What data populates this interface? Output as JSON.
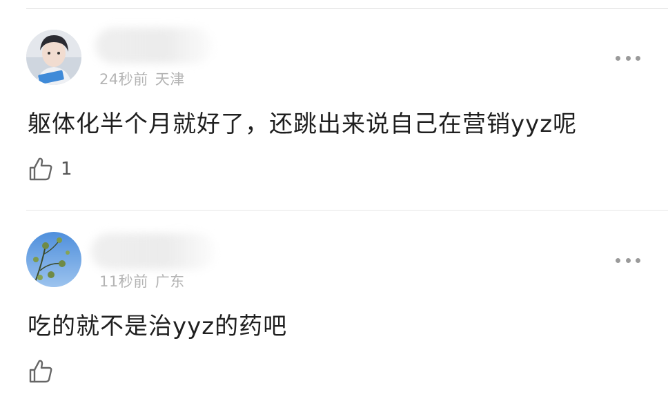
{
  "comments": [
    {
      "time": "24秒前",
      "location": "天津",
      "text": "躯体化半个月就好了，还跳出来说自己在营销yyz呢",
      "likes": "1",
      "avatar_icon": "avatar-person-photo"
    },
    {
      "time": "11秒前",
      "location": "广东",
      "text": "吃的就不是治yyz的药吧",
      "likes": "",
      "avatar_icon": "avatar-sky-tree-photo"
    }
  ],
  "icons": {
    "more": "more-dots-icon",
    "like": "thumbs-up-icon"
  },
  "colors": {
    "meta": "#b4b4b4",
    "text": "#1f1f1f",
    "divider": "#e6e6e6"
  }
}
